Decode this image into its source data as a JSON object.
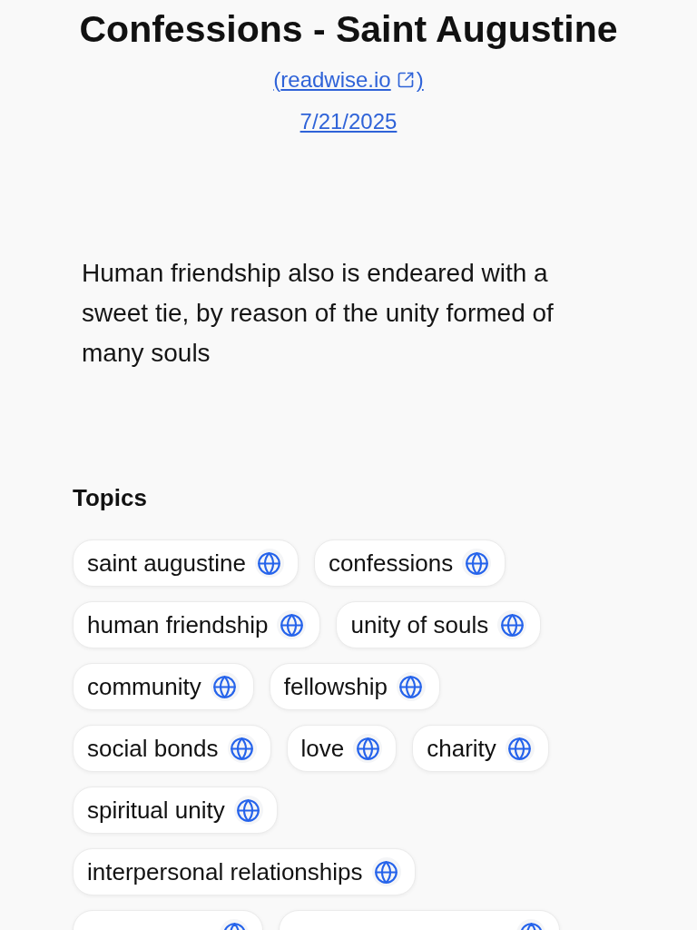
{
  "title": "Confessions - Saint Augustine",
  "source_link": {
    "open": "(",
    "text": "readwise.io",
    "close": ")"
  },
  "date": "7/21/2025",
  "highlight": "Human friendship also is endeared with a sweet tie, by reason of the unity formed of many souls",
  "topics": {
    "heading": "Topics",
    "items": [
      {
        "kind": "topic",
        "label": "saint augustine"
      },
      {
        "kind": "topic",
        "label": "confessions"
      },
      {
        "kind": "topic",
        "label": "human friendship"
      },
      {
        "kind": "topic",
        "label": "unity of souls"
      },
      {
        "kind": "topic",
        "label": "community"
      },
      {
        "kind": "topic",
        "label": "fellowship"
      },
      {
        "kind": "topic",
        "label": "social bonds"
      },
      {
        "kind": "topic",
        "label": "love"
      },
      {
        "kind": "topic",
        "label": "charity"
      },
      {
        "kind": "topic",
        "label": "spiritual unity"
      },
      {
        "kind": "topic",
        "label": "interpersonal relationships"
      },
      {
        "kind": "clipped"
      },
      {
        "kind": "clipped"
      }
    ]
  }
}
